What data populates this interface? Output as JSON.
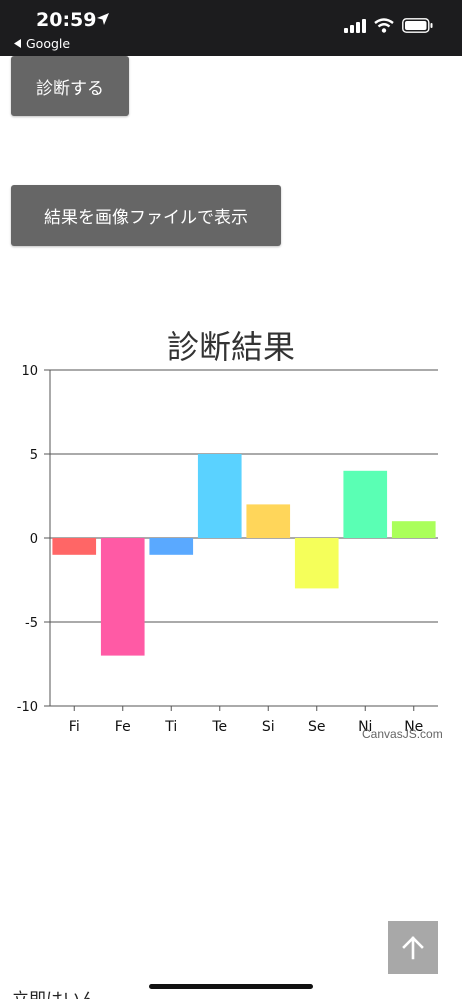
{
  "status_bar": {
    "time": "20:59",
    "back_label": "Google"
  },
  "buttons": {
    "diagnose": "診断する",
    "export": "結果を画像ファイルで表示"
  },
  "footer": {
    "partial_text": "立即はいん"
  },
  "chart_data": {
    "type": "bar",
    "title": "診断結果",
    "categories": [
      "Fi",
      "Fe",
      "Ti",
      "Te",
      "Si",
      "Se",
      "Ni",
      "Ne"
    ],
    "values": [
      -1,
      -7,
      -1,
      5,
      2,
      -3,
      4,
      1
    ],
    "colors": [
      "#ff6666",
      "#ff5aa5",
      "#5aa9ff",
      "#5ad2ff",
      "#ffd65a",
      "#f5ff5a",
      "#5affb4",
      "#aaff5a"
    ],
    "ylim": [
      -10,
      10
    ],
    "yticks": [
      10,
      5,
      0,
      -5,
      -10
    ],
    "grid": true,
    "credit": "CanvasJS.com"
  }
}
